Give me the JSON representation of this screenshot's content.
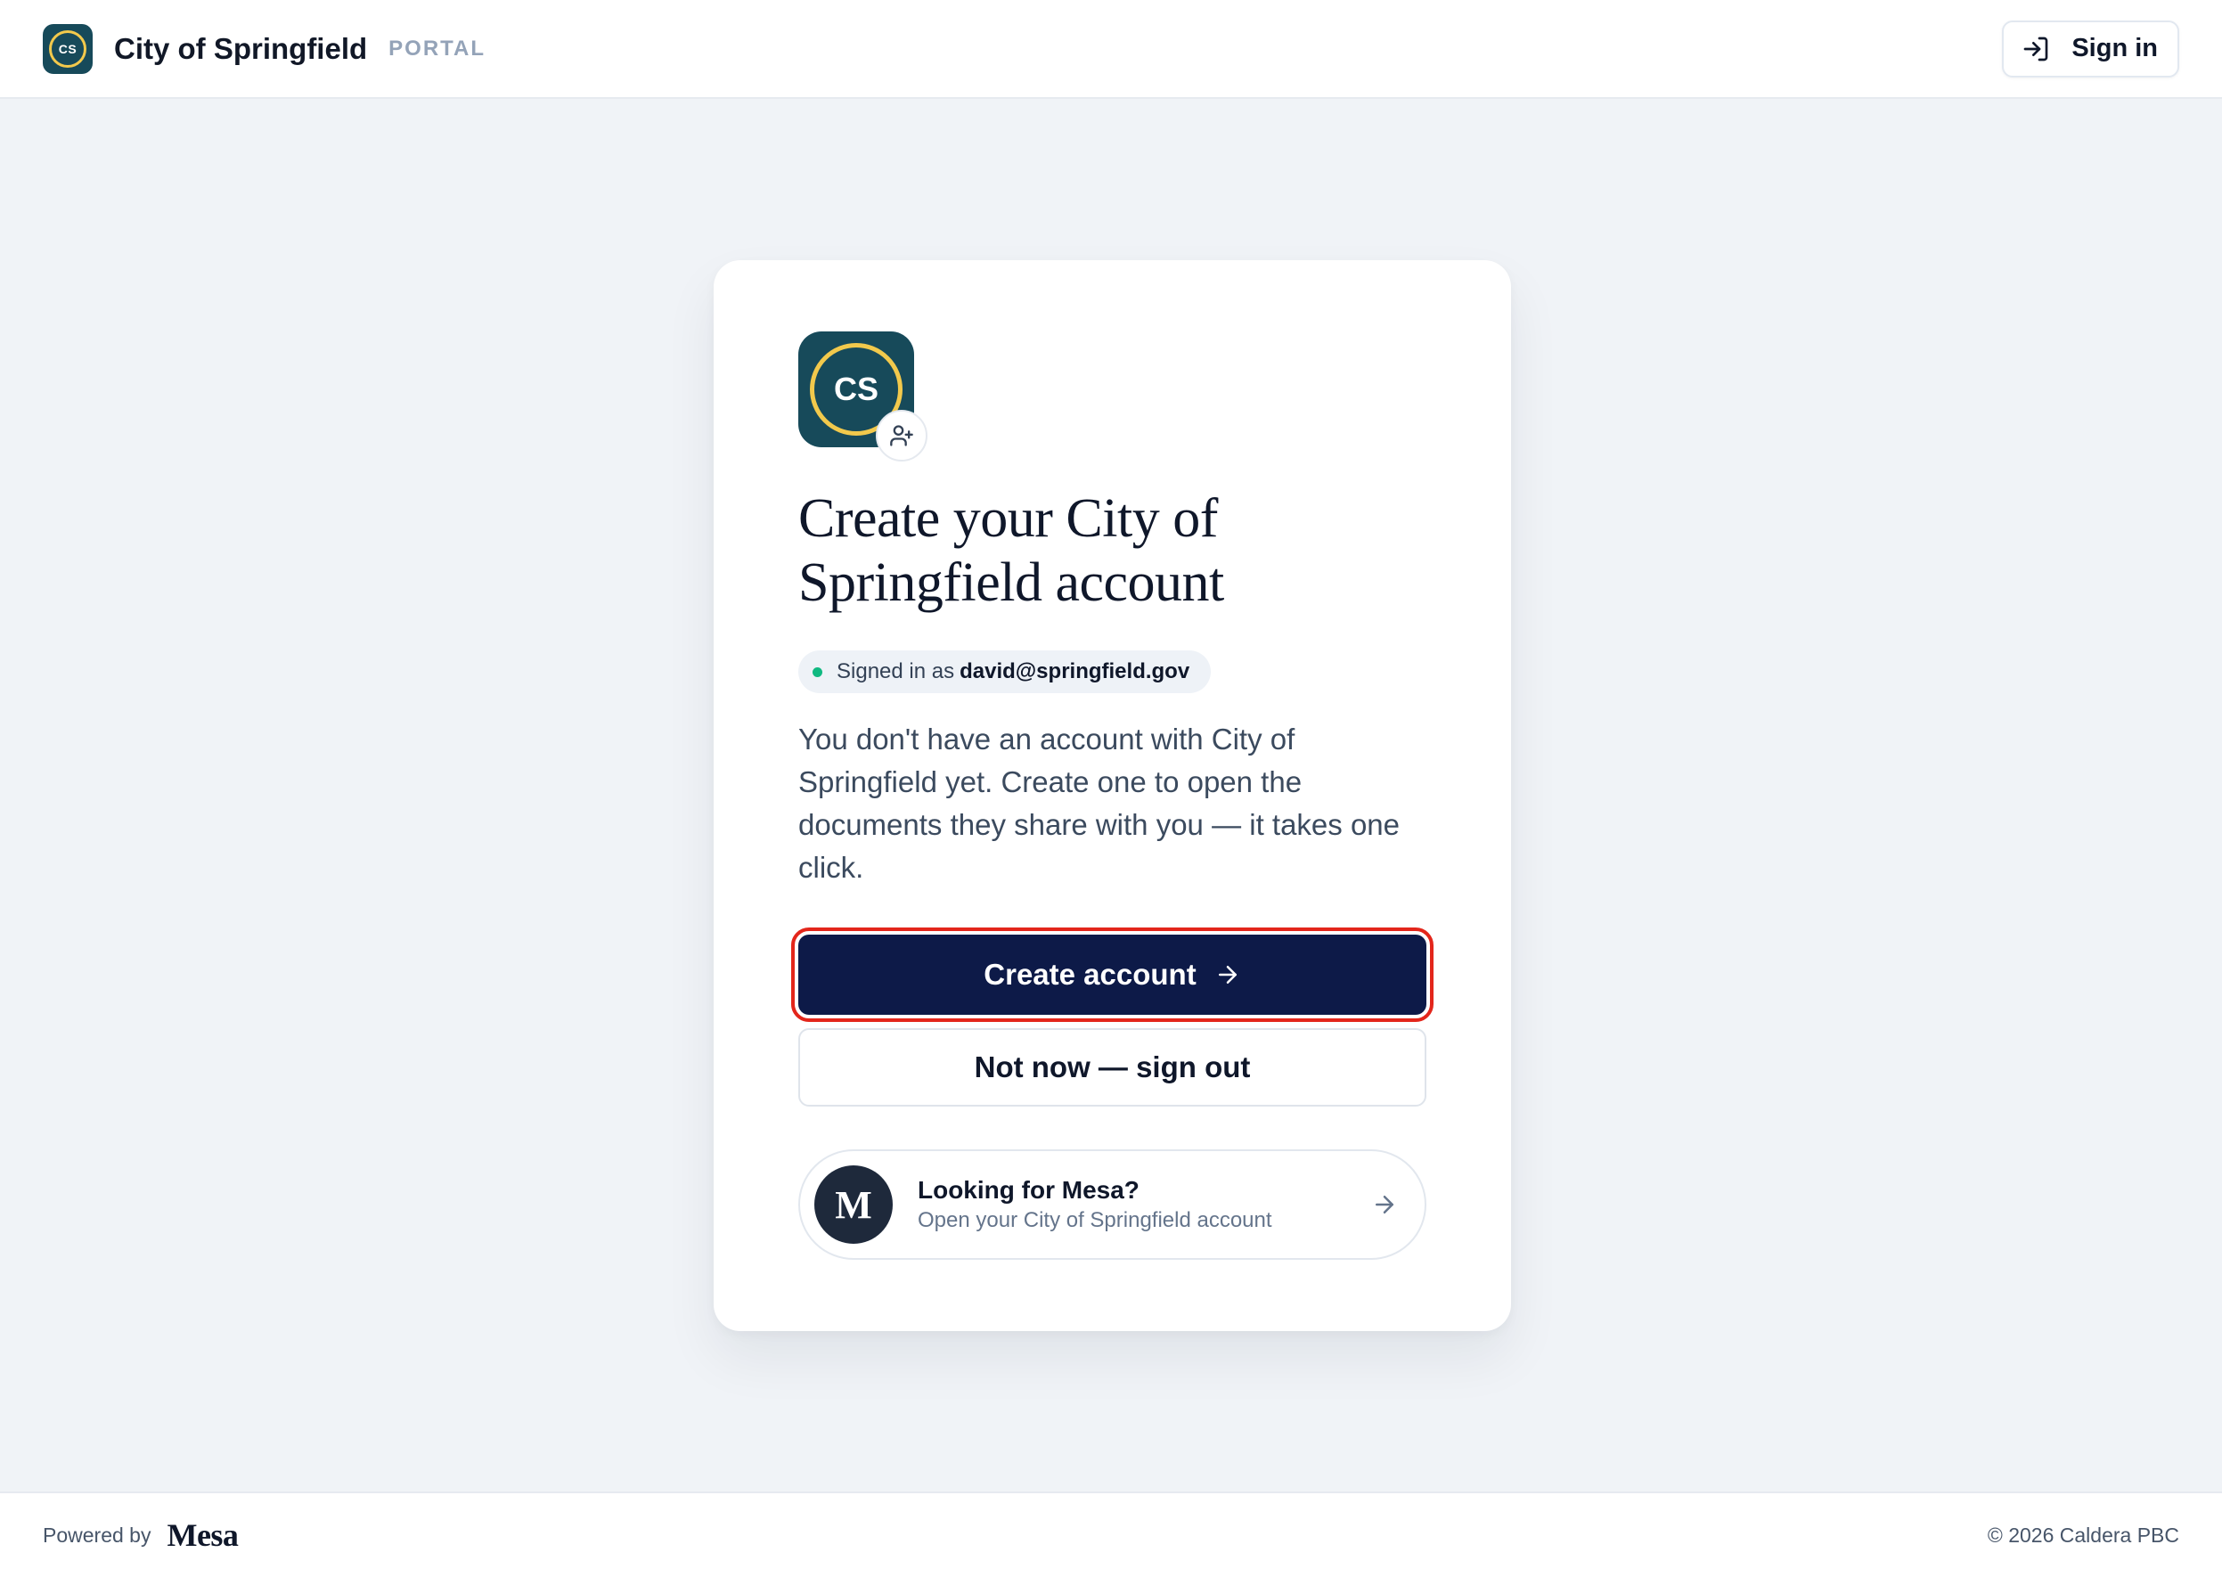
{
  "header": {
    "logo_initials": "CS",
    "title": "City of Springfield",
    "tag": "PORTAL",
    "signin_label": "Sign in",
    "signin_icon": "log-in-icon"
  },
  "card": {
    "app_icon_initials": "CS",
    "badge_icon": "user-plus-icon",
    "heading_line1": "Create your City of",
    "heading_line2": "Springfield account",
    "signed_in_prefix": "Signed in as",
    "signed_in_email": "david@springfield.gov",
    "description": "You don't have an account with City of Springfield yet. Create one to open the documents they share with you — it takes one click.",
    "primary_button": "Create account",
    "primary_button_icon": "arrow-right-icon",
    "secondary_button": "Not now — sign out",
    "mesa": {
      "avatar_letter": "M",
      "title": "Looking for Mesa?",
      "subtitle": "Open your City of Springfield account",
      "icon": "arrow-right-icon"
    }
  },
  "footer": {
    "powered_by": "Powered by",
    "brand": "Mesa",
    "copyright": "© 2026 Caldera PBC"
  },
  "colors": {
    "brand_teal": "#174a5a",
    "brand_gold": "#f2c94c",
    "primary_navy": "#0d1a48",
    "status_green": "#10b981",
    "highlight_red": "#e3261b",
    "page_background": "#f0f3f7"
  }
}
